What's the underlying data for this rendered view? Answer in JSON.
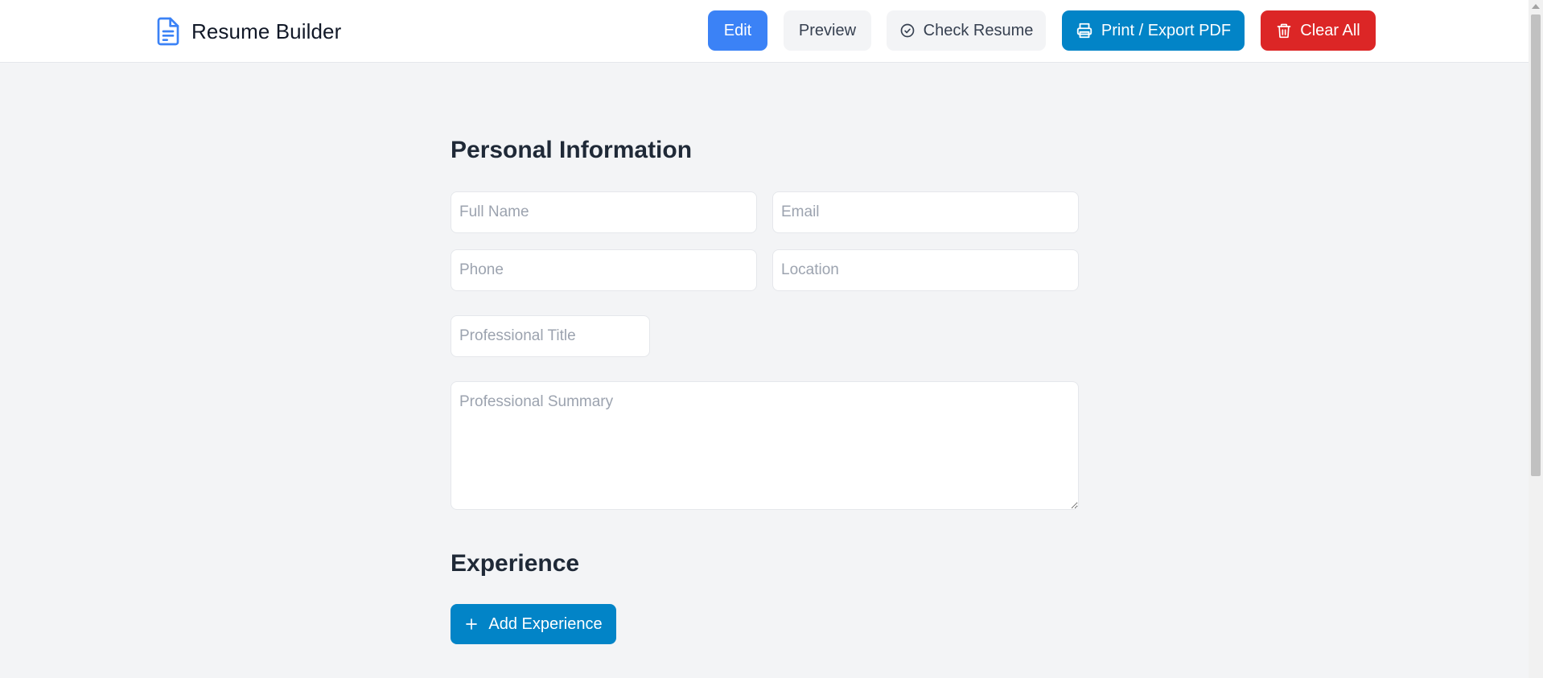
{
  "app": {
    "title": "Resume Builder",
    "icon": "document-icon"
  },
  "toolbar": {
    "edit_label": "Edit",
    "preview_label": "Preview",
    "check_label": "Check Resume",
    "print_label": "Print / Export PDF",
    "clear_label": "Clear All"
  },
  "personal": {
    "heading": "Personal Information",
    "full_name": {
      "placeholder": "Full Name",
      "value": ""
    },
    "email": {
      "placeholder": "Email",
      "value": ""
    },
    "phone": {
      "placeholder": "Phone",
      "value": ""
    },
    "location": {
      "placeholder": "Location",
      "value": ""
    },
    "title": {
      "placeholder": "Professional Title",
      "value": ""
    },
    "summary": {
      "placeholder": "Professional Summary",
      "value": ""
    }
  },
  "experience": {
    "heading": "Experience",
    "add_label": "Add Experience"
  },
  "colors": {
    "accent_blue": "#3b82f6",
    "primary_sky": "#0284c7",
    "danger_red": "#dc2626",
    "page_bg": "#f3f4f6"
  }
}
